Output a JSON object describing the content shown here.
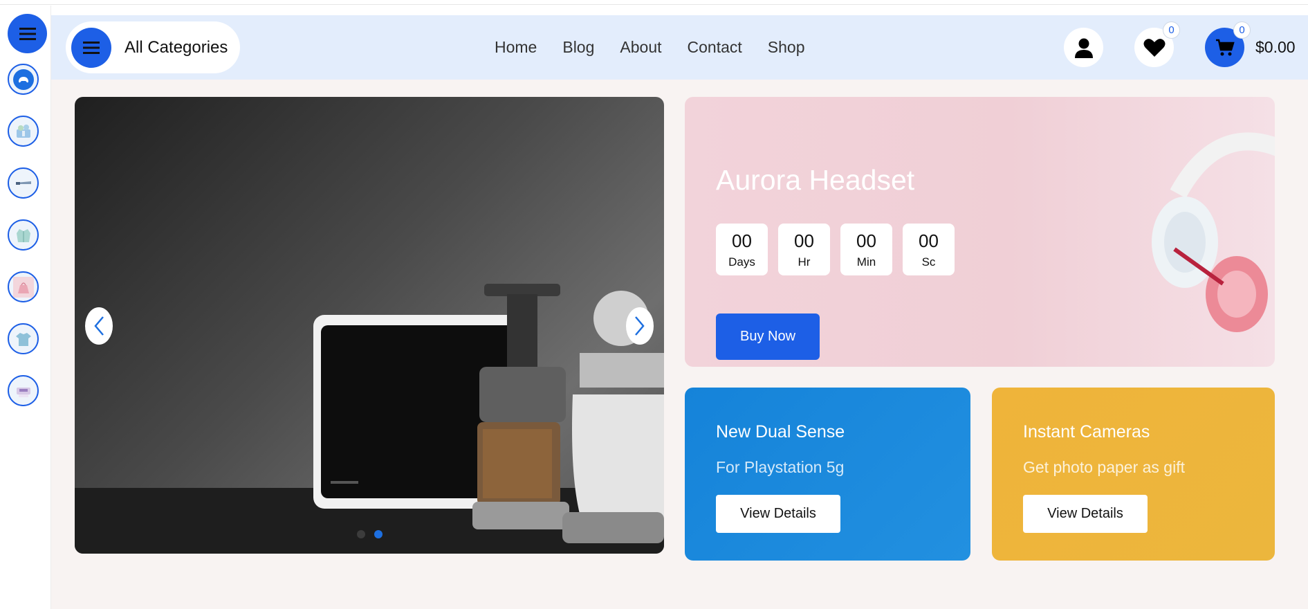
{
  "header": {
    "categories_label": "All Categories",
    "nav": [
      "Home",
      "Blog",
      "About",
      "Contact",
      "Shop"
    ],
    "wishlist_count": "0",
    "cart_count": "0",
    "cart_total": "$0.00"
  },
  "sidebar": {
    "items": [
      {
        "icon": "gamepad-icon"
      },
      {
        "icon": "gift-hamper-icon"
      },
      {
        "icon": "hair-straightener-icon"
      },
      {
        "icon": "jacket-icon"
      },
      {
        "icon": "handbag-icon"
      },
      {
        "icon": "shirt-icon"
      },
      {
        "icon": "printer-icon"
      }
    ]
  },
  "slider": {
    "slide_count": 2,
    "active_slide": 2
  },
  "promo": {
    "title": "Aurora Headset",
    "countdown": [
      {
        "value": "00",
        "unit": "Days"
      },
      {
        "value": "00",
        "unit": "Hr"
      },
      {
        "value": "00",
        "unit": "Min"
      },
      {
        "value": "00",
        "unit": "Sc"
      }
    ],
    "button": "Buy Now"
  },
  "cards": [
    {
      "title": "New Dual Sense",
      "subtitle": "For Playstation 5g",
      "button": "View Details",
      "color": "#1a86db"
    },
    {
      "title": "Instant Cameras",
      "subtitle": "Get photo paper as gift",
      "button": "View Details",
      "color": "#efb53a"
    }
  ],
  "colors": {
    "primary": "#1d5fe6",
    "header_bg": "#e3edfc",
    "page_bg": "#f8f3f2"
  }
}
